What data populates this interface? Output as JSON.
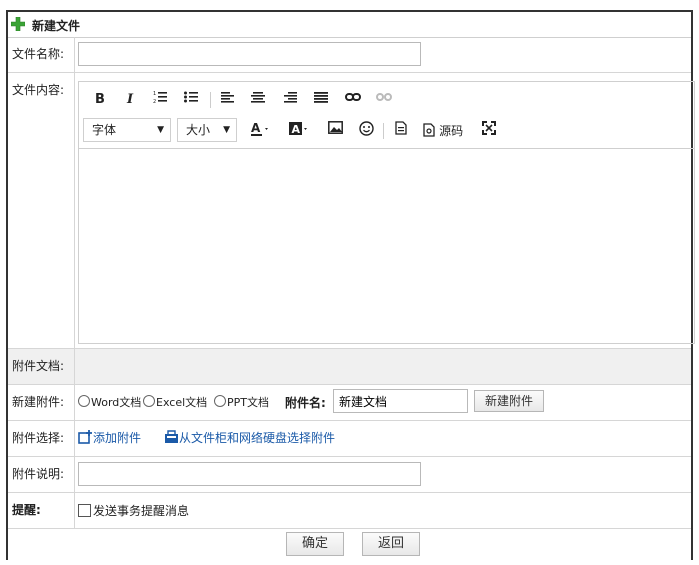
{
  "title": "新建文件",
  "fields": {
    "filename_label": "文件名称:",
    "filename_value": "",
    "content_label": "文件内容:",
    "attachment_doc_label": "附件文档:",
    "new_attachment_label": "新建附件:",
    "attach_select_label": "附件选择:",
    "attach_desc_label": "附件说明:",
    "attach_desc_value": "",
    "remind_label": "提醒:"
  },
  "toolbar": {
    "bold": "B",
    "italic": "I",
    "font_select": "字体",
    "size_select": "大小",
    "source_label": "源码"
  },
  "new_attachment": {
    "radio_word": "Word文档",
    "radio_excel": "Excel文档",
    "radio_ppt": "PPT文档",
    "name_label": "附件名:",
    "name_value": "新建文档",
    "create_button": "新建附件"
  },
  "attach_select": {
    "add_attachment": "添加附件",
    "from_cabinet": "从文件柜和网络硬盘选择附件"
  },
  "remind": {
    "checkbox_label": "发送事务提醒消息"
  },
  "actions": {
    "ok": "确定",
    "back": "返回"
  }
}
